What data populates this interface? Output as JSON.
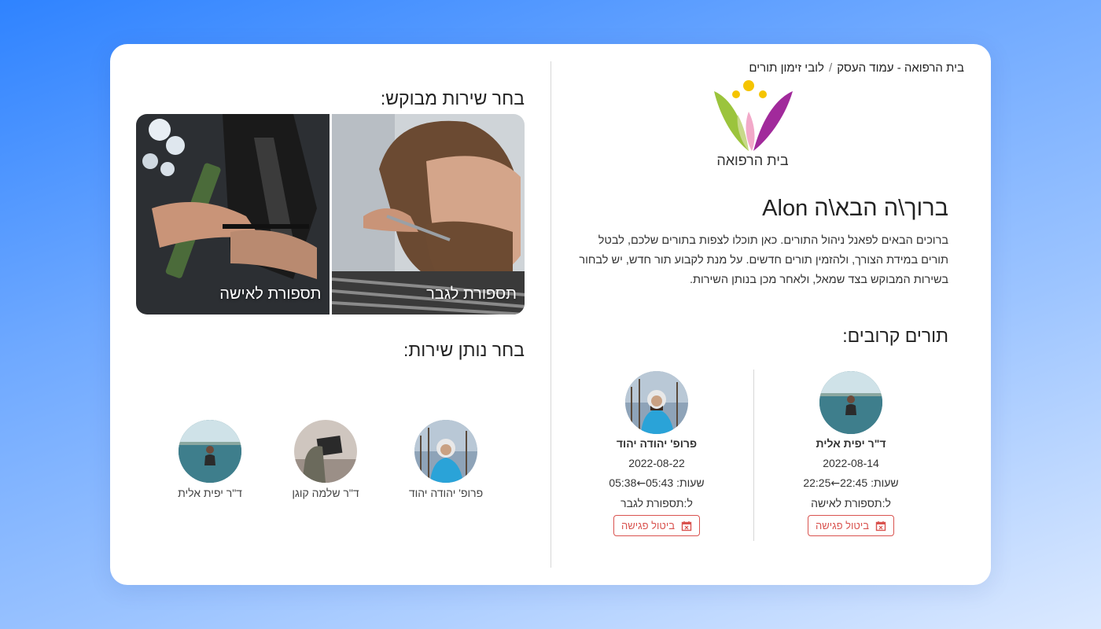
{
  "breadcrumb": {
    "home": "בית הרפואה - עמוד העסק",
    "separator": "/",
    "current": "לובי זימון תורים"
  },
  "logo": {
    "text": "בית הרפואה",
    "colors": [
      "#f5c400",
      "#9bc43c",
      "#a12a9b",
      "#f2a9c9"
    ]
  },
  "welcome": {
    "title": "ברוך\\ה הבא\\ה Alon",
    "intro": "ברוכים הבאים לפאנל ניהול התורים. כאן תוכלו לצפות בתורים שלכם, לבטל תורים במידת הצורך, ולהזמין תורים חדשים. על מנת לקבוע תור חדש, יש לבחור בשירות המבוקש בצד שמאל, ולאחר מכן בנותן השירות."
  },
  "upcoming": {
    "title": "תורים קרובים:",
    "appointments": [
      {
        "provider": "ד\"ר יפית אלית",
        "date": "2022-08-14",
        "hours_label": "שעות:",
        "start": "22:45",
        "end": "22:25",
        "service": "ל:תספורת לאישה",
        "cancel_label": "ביטול פגישה",
        "avatar": "swimmer"
      },
      {
        "provider": "פרופ' יהודה יהוד",
        "date": "2022-08-22",
        "hours_label": "שעות:",
        "start": "05:43",
        "end": "05:38",
        "service": "ל:תספורת לגבר",
        "cancel_label": "ביטול פגישה",
        "avatar": "hoodie"
      }
    ]
  },
  "services": {
    "title": "בחר שירות מבוקש:",
    "items": [
      {
        "label": "תספורת לגבר",
        "image": "barber-man"
      },
      {
        "label": "תספורת לאישה",
        "image": "haircut-woman"
      }
    ]
  },
  "providers": {
    "title": "בחר נותן שירות:",
    "items": [
      {
        "name": "פרופ' יהודה יהוד",
        "avatar": "hoodie"
      },
      {
        "name": "ד\"ר שלמה קוגן",
        "avatar": "laptop"
      },
      {
        "name": "ד\"ר יפית אלית",
        "avatar": "swimmer"
      }
    ]
  },
  "colors": {
    "danger": "#d9534f",
    "divider": "#d7d7d7"
  }
}
